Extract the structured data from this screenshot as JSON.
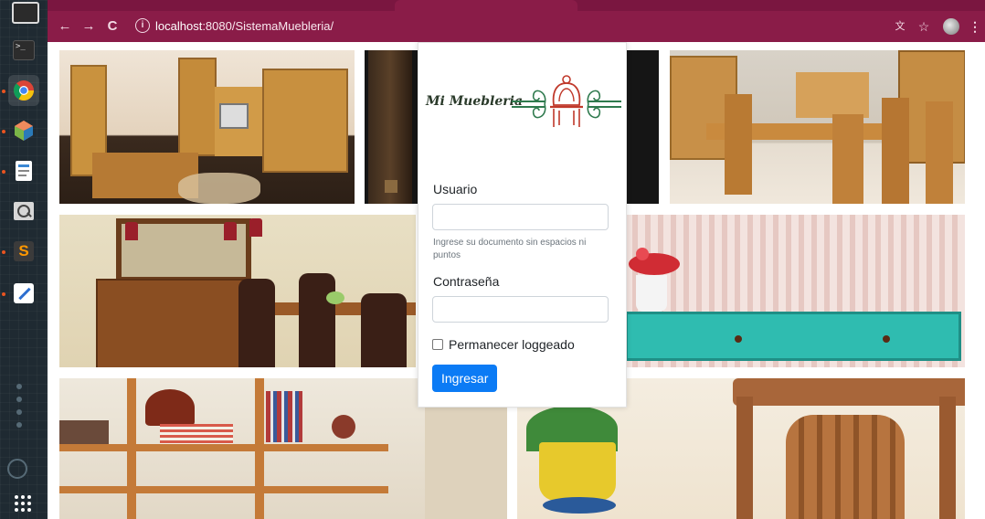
{
  "browser": {
    "url_host": "localhost",
    "url_rest": ":8080/SistemaMuebleria/"
  },
  "dock": {
    "apps": [
      {
        "name": "terminal-icon"
      },
      {
        "name": "chrome-icon"
      },
      {
        "name": "software-center-icon"
      },
      {
        "name": "text-editor-icon"
      },
      {
        "name": "screenshot-icon"
      },
      {
        "name": "sublime-text-icon"
      },
      {
        "name": "notes-icon"
      }
    ]
  },
  "login": {
    "logo_text": "Mi Muebleria",
    "user_label": "Usuario",
    "user_value": "",
    "user_help": "Ingrese su documento sin espacios ni puntos",
    "password_label": "Contraseña",
    "password_value": "",
    "remember_label": "Permanecer loggeado",
    "submit_label": "Ingresar"
  },
  "colors": {
    "browser_theme": "#8a1c48",
    "primary_button": "#0b7bf5",
    "logo_green": "#2f7a4e",
    "logo_red": "#c0392b"
  },
  "gallery": [
    {
      "name": "living-room-photo"
    },
    {
      "name": "dark-cabinet-photo"
    },
    {
      "name": "dining-room-photo"
    },
    {
      "name": "sideboard-dining-photo"
    },
    {
      "name": "turquoise-console-photo"
    },
    {
      "name": "bookshelf-photo"
    },
    {
      "name": "wooden-chair-photo"
    }
  ]
}
